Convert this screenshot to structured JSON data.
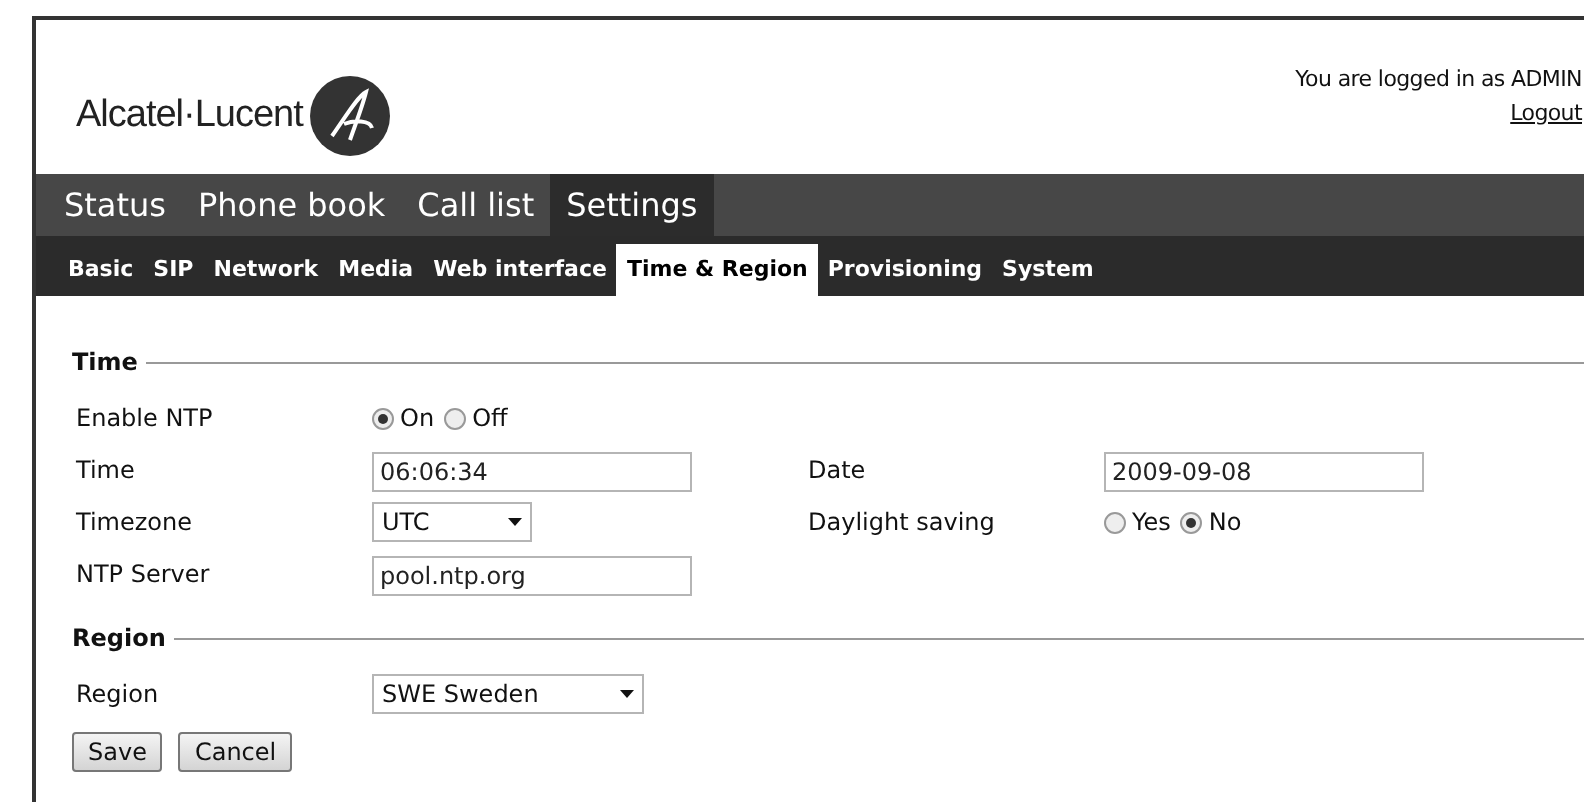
{
  "header": {
    "logo_text": "Alcatel·Lucent",
    "login_text": "You are logged in as ADMIN",
    "logout": "Logout"
  },
  "main_nav": [
    {
      "label": "Status",
      "selected": false
    },
    {
      "label": "Phone book",
      "selected": false
    },
    {
      "label": "Call list",
      "selected": false
    },
    {
      "label": "Settings",
      "selected": true
    }
  ],
  "sub_nav": [
    {
      "label": "Basic",
      "selected": false
    },
    {
      "label": "SIP",
      "selected": false
    },
    {
      "label": "Network",
      "selected": false
    },
    {
      "label": "Media",
      "selected": false
    },
    {
      "label": "Web interface",
      "selected": false
    },
    {
      "label": "Time & Region",
      "selected": true
    },
    {
      "label": "Provisioning",
      "selected": false
    },
    {
      "label": "System",
      "selected": false
    }
  ],
  "sections": [
    {
      "title": "Time",
      "rows": [
        [
          {
            "label": "Enable NTP",
            "kind": "radio",
            "options": [
              {
                "label": "On",
                "selected": true
              },
              {
                "label": "Off",
                "selected": false
              }
            ]
          }
        ],
        [
          {
            "label": "Time",
            "kind": "text",
            "value": "06:06:34"
          },
          {
            "label": "Date",
            "kind": "text",
            "value": "2009-09-08"
          }
        ],
        [
          {
            "label": "Timezone",
            "kind": "select",
            "value": "UTC"
          },
          {
            "label": "Daylight saving",
            "kind": "radio",
            "options": [
              {
                "label": "Yes",
                "selected": false
              },
              {
                "label": "No",
                "selected": true
              }
            ]
          }
        ],
        [
          {
            "label": "NTP Server",
            "kind": "text",
            "value": "pool.ntp.org"
          }
        ]
      ]
    },
    {
      "title": "Region",
      "rows": [
        [
          {
            "label": "Region",
            "kind": "select",
            "value": "SWE Sweden"
          }
        ]
      ]
    }
  ],
  "buttons": [
    "Save",
    "Cancel"
  ]
}
